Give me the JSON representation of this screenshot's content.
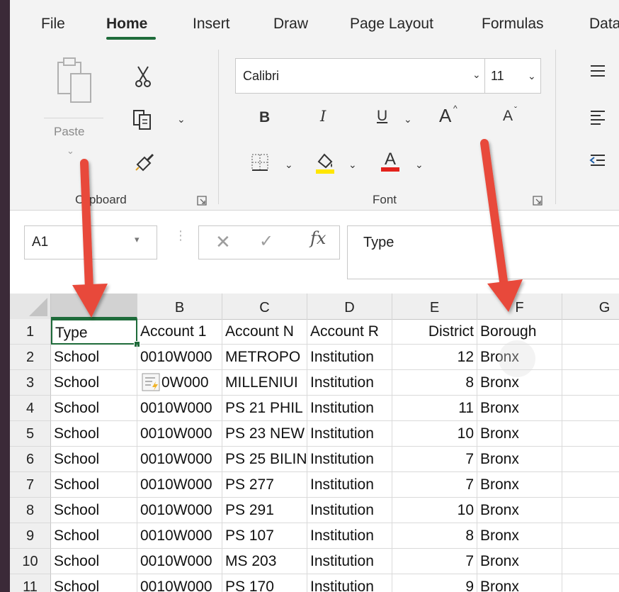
{
  "ribbon": {
    "tabs": [
      {
        "label": "File"
      },
      {
        "label": "Home",
        "active": true
      },
      {
        "label": "Insert"
      },
      {
        "label": "Draw"
      },
      {
        "label": "Page Layout"
      },
      {
        "label": "Formulas"
      },
      {
        "label": "Data"
      }
    ],
    "clipboard": {
      "paste_label": "Paste",
      "group_label": "Clipboard"
    },
    "font": {
      "font_name": "Calibri",
      "font_size": "11",
      "group_label": "Font",
      "bold": "B",
      "italic": "I",
      "underline": "U",
      "grow": "A",
      "shrink": "A",
      "font_color": "A"
    }
  },
  "formula_bar": {
    "name_box": "A1",
    "cancel": "✕",
    "enter": "✓",
    "fx": "fx",
    "formula": "Type"
  },
  "sheet": {
    "columns": [
      "B",
      "C",
      "D",
      "E",
      "F",
      "G"
    ],
    "rows": [
      {
        "n": "1",
        "a": "Type",
        "b": "Account 1",
        "c": "Account N",
        "d": "Account R",
        "e": "District",
        "f": "Borough"
      },
      {
        "n": "2",
        "a": "School",
        "b": "0010W000",
        "c": "METROPO",
        "d": "Institution",
        "e": "12",
        "f": "Bronx"
      },
      {
        "n": "3",
        "a": "School",
        "b": "0W000",
        "c": "MILLENIUI",
        "d": "Institution",
        "e": "8",
        "f": "Bronx"
      },
      {
        "n": "4",
        "a": "School",
        "b": "0010W000",
        "c": "PS 21 PHIL",
        "d": "Institution",
        "e": "11",
        "f": "Bronx"
      },
      {
        "n": "5",
        "a": "School",
        "b": "0010W000",
        "c": "PS 23 NEW",
        "d": "Institution",
        "e": "10",
        "f": "Bronx"
      },
      {
        "n": "6",
        "a": "School",
        "b": "0010W000",
        "c": "PS 25 BILIN",
        "d": "Institution",
        "e": "7",
        "f": "Bronx"
      },
      {
        "n": "7",
        "a": "School",
        "b": "0010W000",
        "c": "PS 277",
        "d": "Institution",
        "e": "7",
        "f": "Bronx"
      },
      {
        "n": "8",
        "a": "School",
        "b": "0010W000",
        "c": "PS 291",
        "d": "Institution",
        "e": "10",
        "f": "Bronx"
      },
      {
        "n": "9",
        "a": "School",
        "b": "0010W000",
        "c": "PS 107",
        "d": "Institution",
        "e": "8",
        "f": "Bronx"
      },
      {
        "n": "10",
        "a": "School",
        "b": "0010W000",
        "c": "MS 203",
        "d": "Institution",
        "e": "7",
        "f": "Bronx"
      },
      {
        "n": "11",
        "a": "School",
        "b": "0010W000",
        "c": "PS 170",
        "d": "Institution",
        "e": "9",
        "f": "Bronx"
      }
    ]
  },
  "colors": {
    "accent": "#1e6b3a",
    "annotation_arrow": "#e8493a",
    "highlight_yellow": "#ffe600",
    "font_color_red": "#e3221c"
  }
}
